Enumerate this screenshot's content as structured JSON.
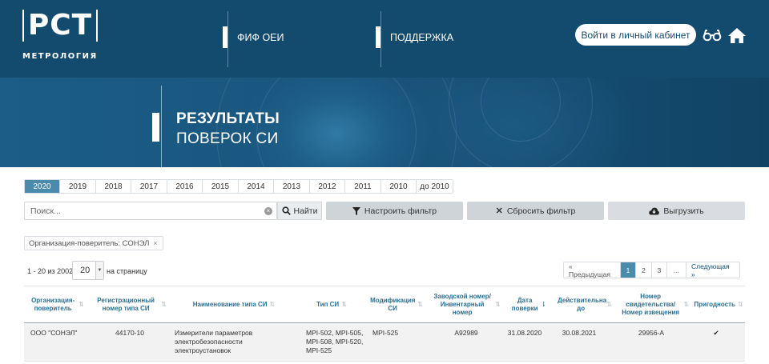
{
  "header": {
    "logo": {
      "mark": "РСТ",
      "text": "МЕТРОЛОГИЯ"
    },
    "nav": [
      {
        "label": "ФИФ ОЕИ"
      },
      {
        "label": "ПОДДЕРЖКА"
      }
    ],
    "cabinet_button": "Войти в личный кабинет",
    "icons": [
      "glasses-icon",
      "home-icon"
    ]
  },
  "banner": {
    "title_line1": "РЕЗУЛЬТАТЫ",
    "title_line2": "ПОВЕРОК СИ"
  },
  "years": {
    "active": "2020",
    "items": [
      "2020",
      "2019",
      "2018",
      "2017",
      "2016",
      "2015",
      "2014",
      "2013",
      "2012",
      "2011",
      "2010",
      "до 2010"
    ]
  },
  "search": {
    "placeholder": "Поиск...",
    "value": "",
    "find_label": "Найти"
  },
  "actions": {
    "configure_filter": "Настроить фильтр",
    "reset_filter": "Сбросить фильтр",
    "export": "Выгрузить"
  },
  "filter_chip": {
    "label": "Организация-поверитель: СОНЭЛ",
    "remove": "×"
  },
  "pagination": {
    "range_text": "1 - 20 из 2002",
    "per_page_value": "20",
    "per_page_label": "на страницу",
    "prev": "« Предыдущая",
    "pages": [
      "1",
      "2",
      "3",
      "..."
    ],
    "active_page": "1",
    "next": "Следующая »"
  },
  "table": {
    "columns": [
      "Организация-поверитель",
      "Регистрационный номер типа СИ",
      "Наименование типа СИ",
      "Тип СИ",
      "Модификация СИ",
      "Заводской номер/ Инвентарный номер",
      "Дата поверки",
      "Действительна до",
      "Номер свидетельства/ Номер извещения",
      "Пригодность"
    ],
    "rows": [
      {
        "org": "ООО \"СОНЭЛ\"",
        "reg_number": "44170-10",
        "type_name": "Измерители параметров электробезопасности электроустановок",
        "type": "MPI-502, MPI-505, MPI-508, MPI-520, MPI-525",
        "modification": "MPI-525",
        "serial": "A92989",
        "verification_date": "31.08.2020",
        "valid_until": "30.08.2021",
        "certificate": "29956-А",
        "suitable": "✔"
      }
    ]
  }
}
